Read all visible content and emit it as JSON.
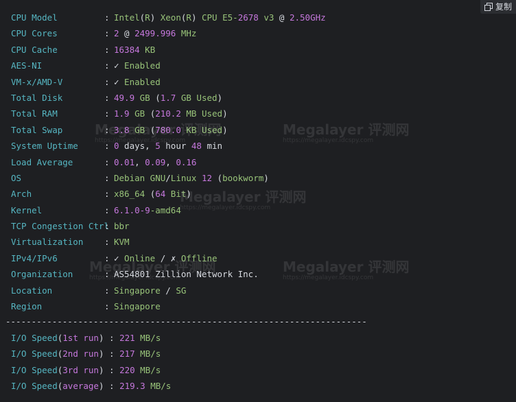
{
  "copy_button": {
    "label": "复制",
    "icon": "copy-icon"
  },
  "rows": [
    {
      "key": "CPU Model",
      "parts": [
        {
          "t": "Intel",
          "c": "g"
        },
        {
          "t": "(",
          "c": "w"
        },
        {
          "t": "R",
          "c": "g"
        },
        {
          "t": ")",
          "c": "w"
        },
        {
          "t": " Xeon",
          "c": "g"
        },
        {
          "t": "(",
          "c": "w"
        },
        {
          "t": "R",
          "c": "g"
        },
        {
          "t": ")",
          "c": "w"
        },
        {
          "t": " CPU E5-",
          "c": "g"
        },
        {
          "t": "2678",
          "c": "n"
        },
        {
          "t": " v3 ",
          "c": "g"
        },
        {
          "t": "@",
          "c": "w"
        },
        {
          "t": " ",
          "c": "w"
        },
        {
          "t": "2.50GHz",
          "c": "n"
        }
      ]
    },
    {
      "key": "CPU Cores",
      "parts": [
        {
          "t": "2",
          "c": "n"
        },
        {
          "t": " @ ",
          "c": "w"
        },
        {
          "t": "2499.996",
          "c": "n"
        },
        {
          "t": " MHz",
          "c": "g"
        }
      ]
    },
    {
      "key": "CPU Cache",
      "parts": [
        {
          "t": "16384",
          "c": "n"
        },
        {
          "t": " KB",
          "c": "g"
        }
      ]
    },
    {
      "key": "AES-NI",
      "parts": [
        {
          "t": "✓",
          "c": "w"
        },
        {
          "t": " Enabled",
          "c": "g"
        }
      ]
    },
    {
      "key": "VM-x/AMD-V",
      "parts": [
        {
          "t": "✓",
          "c": "w"
        },
        {
          "t": " Enabled",
          "c": "g"
        }
      ]
    },
    {
      "key": "Total Disk",
      "parts": [
        {
          "t": "49.9",
          "c": "n"
        },
        {
          "t": " GB ",
          "c": "g"
        },
        {
          "t": "(",
          "c": "w"
        },
        {
          "t": "1.7",
          "c": "n"
        },
        {
          "t": " GB Used",
          "c": "g"
        },
        {
          "t": ")",
          "c": "w"
        }
      ]
    },
    {
      "key": "Total RAM",
      "parts": [
        {
          "t": "1.9",
          "c": "n"
        },
        {
          "t": " GB ",
          "c": "g"
        },
        {
          "t": "(",
          "c": "w"
        },
        {
          "t": "210.2",
          "c": "n"
        },
        {
          "t": " MB Used",
          "c": "g"
        },
        {
          "t": ")",
          "c": "w"
        }
      ]
    },
    {
      "key": "Total Swap",
      "parts": [
        {
          "t": "3.8",
          "c": "n"
        },
        {
          "t": " GB ",
          "c": "g"
        },
        {
          "t": "(",
          "c": "w"
        },
        {
          "t": "780.0",
          "c": "n"
        },
        {
          "t": " KB Used",
          "c": "g"
        },
        {
          "t": ")",
          "c": "w"
        }
      ]
    },
    {
      "key": "System Uptime",
      "parts": [
        {
          "t": "0",
          "c": "n"
        },
        {
          "t": " days, ",
          "c": "w"
        },
        {
          "t": "5",
          "c": "n"
        },
        {
          "t": " hour ",
          "c": "w"
        },
        {
          "t": "48",
          "c": "n"
        },
        {
          "t": " min",
          "c": "w"
        }
      ]
    },
    {
      "key": "Load Average",
      "parts": [
        {
          "t": "0.01",
          "c": "n"
        },
        {
          "t": ", ",
          "c": "w"
        },
        {
          "t": "0.09",
          "c": "n"
        },
        {
          "t": ", ",
          "c": "w"
        },
        {
          "t": "0.16",
          "c": "n"
        }
      ]
    },
    {
      "key": "OS",
      "parts": [
        {
          "t": "Debian GNU",
          "c": "g"
        },
        {
          "t": "/",
          "c": "w"
        },
        {
          "t": "Linux ",
          "c": "g"
        },
        {
          "t": "12",
          "c": "n"
        },
        {
          "t": " (",
          "c": "w"
        },
        {
          "t": "bookworm",
          "c": "g"
        },
        {
          "t": ")",
          "c": "w"
        }
      ]
    },
    {
      "key": "Arch",
      "parts": [
        {
          "t": "x86_64 ",
          "c": "g"
        },
        {
          "t": "(",
          "c": "w"
        },
        {
          "t": "64",
          "c": "n"
        },
        {
          "t": " Bit",
          "c": "g"
        },
        {
          "t": ")",
          "c": "w"
        }
      ]
    },
    {
      "key": "Kernel",
      "parts": [
        {
          "t": "6.1.0-9",
          "c": "n"
        },
        {
          "t": "-amd64",
          "c": "g"
        }
      ]
    },
    {
      "key": "TCP Congestion Ctrl",
      "parts": [
        {
          "t": "bbr",
          "c": "g"
        }
      ]
    },
    {
      "key": "Virtualization",
      "parts": [
        {
          "t": "KVM",
          "c": "g"
        }
      ]
    },
    {
      "key": "IPv4/IPv6",
      "parts": [
        {
          "t": "✓",
          "c": "w"
        },
        {
          "t": " Online ",
          "c": "g"
        },
        {
          "t": "/",
          "c": "w"
        },
        {
          "t": " ✗",
          "c": "w"
        },
        {
          "t": " Offline",
          "c": "g"
        }
      ]
    },
    {
      "key": "Organization",
      "parts": [
        {
          "t": "AS54801 Zillion Network Inc.",
          "c": "w"
        }
      ]
    },
    {
      "key": "Location",
      "parts": [
        {
          "t": "Singapore ",
          "c": "g"
        },
        {
          "t": "/",
          "c": "w"
        },
        {
          "t": " SG",
          "c": "g"
        }
      ]
    },
    {
      "key": "Region",
      "parts": [
        {
          "t": "Singapore",
          "c": "g"
        }
      ]
    }
  ],
  "divider": "----------------------------------------------------------------------",
  "io_rows": [
    {
      "label": "I/O Speed",
      "run": "1st run",
      "value": "221",
      "unit": "MB/s"
    },
    {
      "label": "I/O Speed",
      "run": "2nd run",
      "value": "217",
      "unit": "MB/s"
    },
    {
      "label": "I/O Speed",
      "run": "3rd run",
      "value": "220",
      "unit": "MB/s"
    },
    {
      "label": "I/O Speed",
      "run": "average",
      "value": "219.3",
      "unit": "MB/s"
    }
  ],
  "watermark": {
    "title": "Megalayer 评测网",
    "url": "https://megalayer.idcspy.com"
  }
}
